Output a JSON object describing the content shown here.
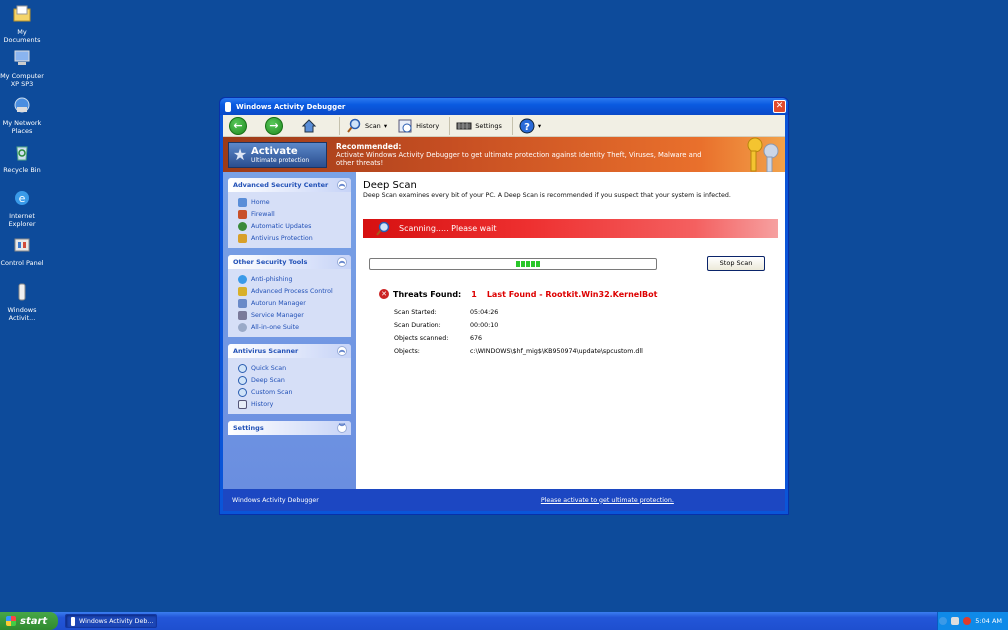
{
  "desktop": {
    "icons": [
      {
        "label": "My Documents",
        "icon": "folder-icon"
      },
      {
        "label": "My Computer XP SP3",
        "icon": "computer-icon"
      },
      {
        "label": "My Network Places",
        "icon": "network-icon"
      },
      {
        "label": "Recycle Bin",
        "icon": "recycle-bin-icon"
      },
      {
        "label": "Internet Explorer",
        "icon": "ie-icon"
      },
      {
        "label": "Control Panel",
        "icon": "control-panel-icon"
      },
      {
        "label": "Windows Activit...",
        "icon": "app-icon"
      }
    ]
  },
  "window": {
    "title": "Windows Activity Debugger",
    "toolbar": {
      "scan_label": "Scan",
      "history_label": "History",
      "settings_label": "Settings"
    },
    "banner": {
      "activate_title": "Activate",
      "activate_sub": "Ultimate protection",
      "recommended_title": "Recommended:",
      "recommended_text": "Activate Windows Activity Debugger to get ultimate protection against Identity Theft, Viruses, Malware and other threats!"
    },
    "sidebar": {
      "panels": [
        {
          "title": "Advanced Security Center",
          "items": [
            "Home",
            "Firewall",
            "Automatic Updates",
            "Antivirus Protection"
          ]
        },
        {
          "title": "Other Security Tools",
          "items": [
            "Anti-phishing",
            "Advanced Process Control",
            "Autorun Manager",
            "Service Manager",
            "All-in-one Suite"
          ]
        },
        {
          "title": "Antivirus Scanner",
          "items": [
            "Quick Scan",
            "Deep Scan",
            "Custom Scan",
            "History"
          ]
        },
        {
          "title": "Settings",
          "items": []
        }
      ]
    },
    "main": {
      "heading": "Deep Scan",
      "description": "Deep Scan examines every bit of your PC. A Deep Scan is recommended if you suspect that your system is infected.",
      "scanning_text": "Scanning..... Please wait",
      "stop_label": "Stop Scan",
      "threats_label": "Threats Found:",
      "threats_count": "1",
      "last_found": "Last Found - Rootkit.Win32.KernelBot",
      "details": [
        {
          "key": "Scan Started:",
          "value": "05:04:26"
        },
        {
          "key": "Scan Duration:",
          "value": "00:00:10"
        },
        {
          "key": "Objects scanned:",
          "value": "676"
        },
        {
          "key": "Objects:",
          "value": "c:\\WINDOWS\\$hf_mig$\\KB950974\\update\\spcustom.dll"
        }
      ]
    },
    "status": {
      "name": "Windows Activity Debugger",
      "link": "Please activate to get ultimate protection."
    }
  },
  "taskbar": {
    "start_label": "start",
    "task_label": "Windows Activity Deb...",
    "clock": "5:04 AM"
  },
  "colors": {
    "desktop": "#0d4b9b",
    "threat_red": "#dd0000",
    "sidebar_link": "#2150b6"
  }
}
